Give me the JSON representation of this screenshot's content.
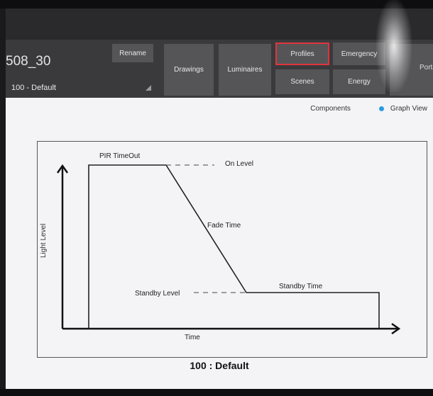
{
  "header": {
    "room_name": "508_30",
    "profile_name": "100 - Default",
    "rename_label": "Rename",
    "nav": {
      "drawings": "Drawings",
      "luminaires": "Luminaires",
      "profiles": "Profiles",
      "emergency": "Emergency",
      "scenes": "Scenes",
      "energy": "Energy",
      "portal": "Portal"
    }
  },
  "view_toggle": {
    "components": "Components",
    "graph_view": "Graph View",
    "selected_color": "#2b9be0"
  },
  "graph": {
    "pir_timeout": "PIR TimeOut",
    "on_level": "On Level",
    "fade_time": "Fade Time",
    "standby_level": "Standby Level",
    "standby_time": "Standby Time",
    "y_axis": "Light Level",
    "x_axis": "Time"
  },
  "footer_title": "100 : Default",
  "colors": {
    "active_tab_border": "#e0343c",
    "button_bg": "#555558",
    "header_bg": "#3a3a3d"
  }
}
